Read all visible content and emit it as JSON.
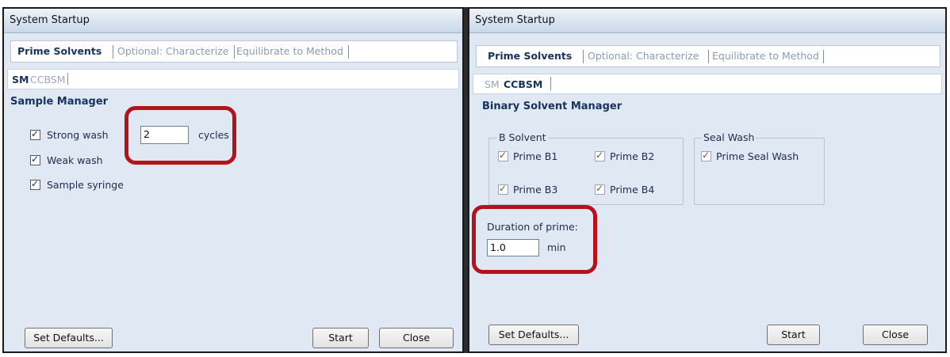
{
  "left": {
    "title": "System Startup",
    "tabs": [
      {
        "label": "Prime Solvents"
      },
      {
        "label": "Optional: Characterize"
      },
      {
        "label": "Equilibrate to Method"
      }
    ],
    "subtabs": [
      {
        "label": "SM"
      },
      {
        "label": "CCBSM"
      }
    ],
    "section_title": "Sample Manager",
    "options": [
      {
        "label": "Strong wash",
        "checked": true
      },
      {
        "label": "Weak wash",
        "checked": true
      },
      {
        "label": "Sample syringe",
        "checked": true
      }
    ],
    "cycles_value": "2",
    "cycles_unit": "cycles",
    "buttons": {
      "set_defaults": "Set Defaults...",
      "start": "Start",
      "close": "Close"
    }
  },
  "right": {
    "title": "System Startup",
    "tabs": [
      {
        "label": "Prime Solvents"
      },
      {
        "label": "Optional: Characterize"
      },
      {
        "label": "Equilibrate to Method"
      }
    ],
    "subtabs": [
      {
        "label": "SM"
      },
      {
        "label": "CCBSM"
      }
    ],
    "section_title": "Binary Solvent Manager",
    "b_solvent": {
      "title": "B Solvent",
      "items": [
        {
          "label": "Prime B1",
          "checked": true
        },
        {
          "label": "Prime B2",
          "checked": true
        },
        {
          "label": "Prime B3",
          "checked": true
        },
        {
          "label": "Prime B4",
          "checked": true
        }
      ]
    },
    "seal_wash": {
      "title": "Seal Wash",
      "items": [
        {
          "label": "Prime Seal Wash",
          "checked": true
        }
      ]
    },
    "duration_label": "Duration of prime:",
    "duration_value": "1.0",
    "duration_unit": "min",
    "buttons": {
      "set_defaults": "Set Defaults...",
      "start": "Start",
      "close": "Close"
    }
  },
  "colors": {
    "highlight": "#b3141c",
    "panel_bg": "#dfe8f3",
    "active_tab_text": "#17325e"
  }
}
